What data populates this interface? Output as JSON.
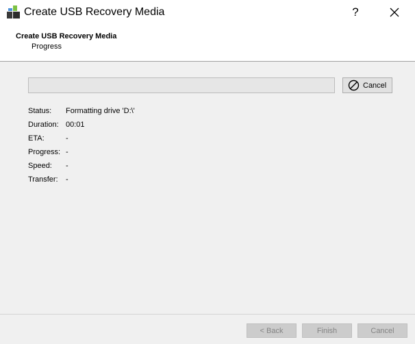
{
  "window": {
    "title": "Create USB Recovery Media",
    "help_glyph": "?",
    "app_icon": "windows-logo-icon"
  },
  "header": {
    "title": "Create USB Recovery Media",
    "subtitle": "Progress"
  },
  "progress": {
    "fraction": 0.0
  },
  "cancel_button": {
    "label": "Cancel",
    "icon": "cancel-circle-icon"
  },
  "info": [
    {
      "label": "Status:",
      "value": "Formatting drive 'D:\\'"
    },
    {
      "label": "Duration:",
      "value": "00:01"
    },
    {
      "label": "ETA:",
      "value": "-"
    },
    {
      "label": "Progress:",
      "value": "-"
    },
    {
      "label": "Speed:",
      "value": "-"
    },
    {
      "label": "Transfer:",
      "value": "-"
    }
  ],
  "footer": {
    "back_label": "< Back",
    "finish_label": "Finish",
    "cancel_label": "Cancel",
    "disabled": true
  }
}
